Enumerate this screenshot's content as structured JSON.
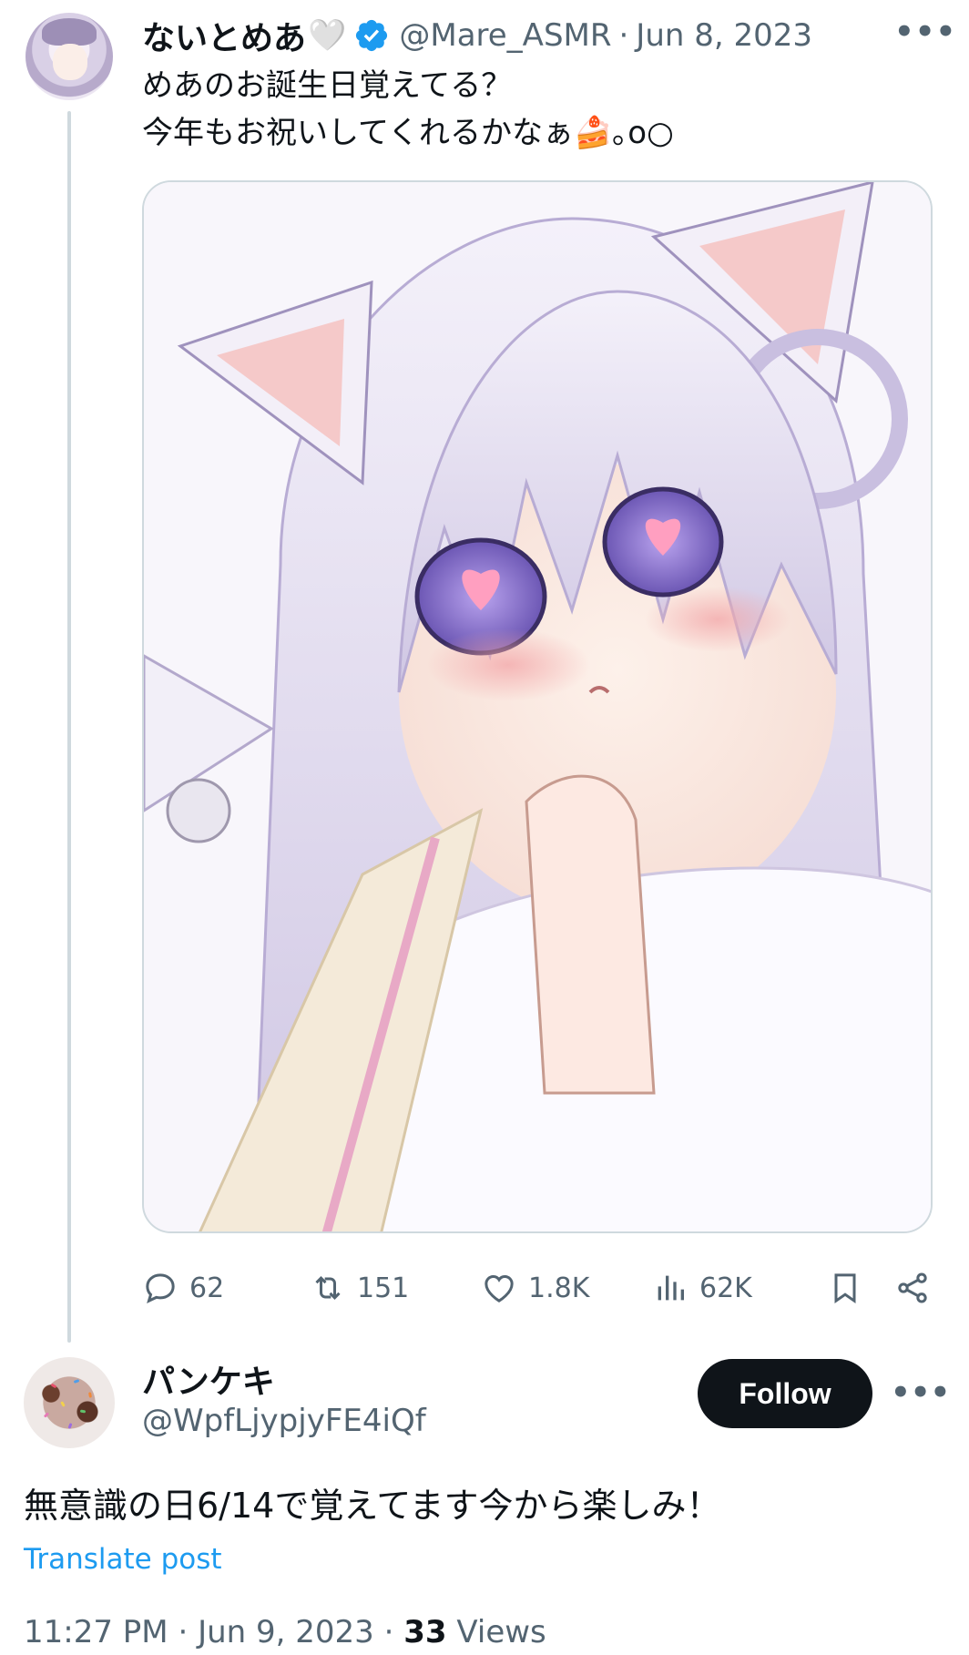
{
  "parent_post": {
    "display_name": "ないとめあ",
    "name_emoji": "🤍",
    "handle": "@Mare_ASMR",
    "separator": "·",
    "date": "Jun 8, 2023",
    "text": "めあのお誕生日覚えてる？\n今年もお祝いしてくれるかなぁ🍰｡o○",
    "media_description_icon": "illustration-image",
    "stats": {
      "replies": "62",
      "reposts": "151",
      "likes": "1.8K",
      "views": "62K"
    }
  },
  "reply_post": {
    "display_name": "パンケキ",
    "handle": "@WpfLjypjyFE4iQf",
    "follow_label": "Follow",
    "text": "無意識の日6/14で覚えてます今から楽しみ！",
    "translate_label": "Translate post",
    "time": "11:27 PM",
    "date": "Jun 9, 2023",
    "view_count": "33",
    "views_label": "Views"
  },
  "colors": {
    "text_primary": "#0f1419",
    "text_secondary": "#536471",
    "link": "#1d9bf0",
    "verified": "#1d9bf0",
    "follow_bg": "#0f1419"
  }
}
